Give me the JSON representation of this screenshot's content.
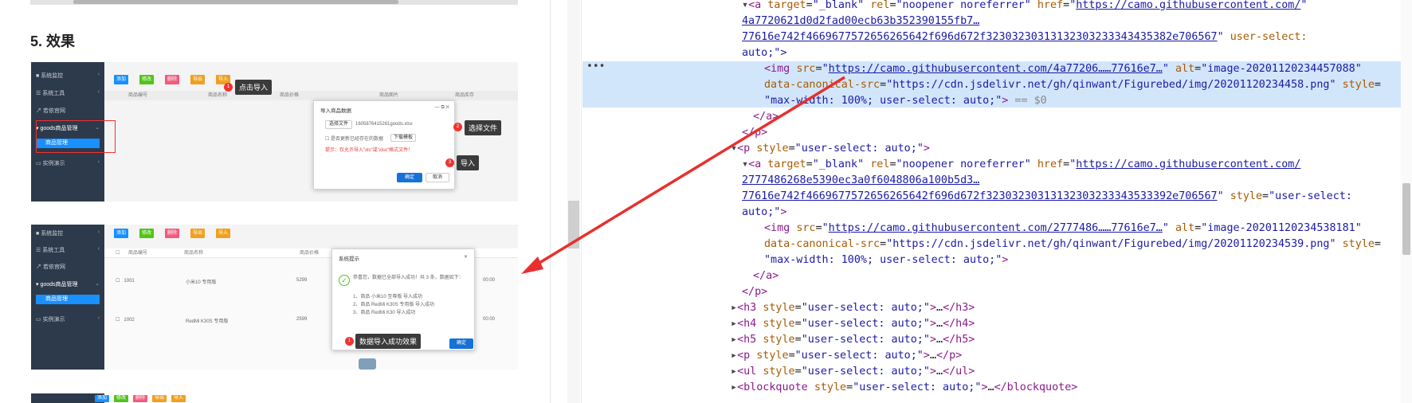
{
  "article": {
    "heading": "5. 效果",
    "shot1": {
      "menu": [
        "系统监控",
        "系统工具",
        "若依官网",
        "goods商品管理"
      ],
      "submenu": "商品管理",
      "toolbar": [
        "添加",
        "修改",
        "删除",
        "导出",
        "导入"
      ],
      "columns": [
        "商品编号",
        "商品名称",
        "商品价格",
        "商品图片",
        "商品库存"
      ],
      "dialog_title": "导入商品数据",
      "choose_file": "选择文件",
      "filename": "1605876415261goods.xlsx",
      "update_option": "是否更新已经存在的数据",
      "download_template": "下载模板",
      "hint": "提示：仅允许导入\"xls\"或\"xlsx\"格式文件！",
      "confirm": "确定",
      "cancel": "取消",
      "steps": [
        "点击导入",
        "选择文件",
        "导入"
      ],
      "nums": [
        "1",
        "2",
        "3"
      ]
    },
    "shot2": {
      "menu": [
        "系统监控",
        "系统工具",
        "若依官网",
        "goods商品管理",
        "实例演示"
      ],
      "submenu": "商品管理",
      "toolbar": [
        "添加",
        "修改",
        "删除",
        "导出",
        "导入"
      ],
      "columns": [
        "商品编号",
        "商品名称",
        "商品价格"
      ],
      "rows": [
        [
          "1001",
          "小米10 专用版",
          "5299"
        ],
        [
          "1002",
          "RedMi K30S 专用版",
          "2599"
        ]
      ],
      "dialog_title": "系统提示",
      "success_msg": "恭喜您，数据已全部导入成功！共 3 条，数据如下：",
      "items": [
        "1、商品 小米10 至尊版 导入成功",
        "2、商品 RedMi K30S 专用版 导入成功",
        "3、商品 RedMi K30 导入成功"
      ],
      "ok": "确定",
      "step": "数据导入成功效果",
      "num": "1",
      "time_snippet": [
        "00:00",
        "00:00"
      ]
    },
    "shot3_toolbar": [
      "添加",
      "修改",
      "删除",
      "导出",
      "导入"
    ]
  },
  "devtools": {
    "dots": "•••",
    "line1_href": "https://camo.githubusercontent.com/",
    "line2_href": "4a7720621d0d2fad00ecb63b352390155fb7…",
    "line3_href": "77616e742f4669677572656265642f696d672f32303230313132303233343435382e706567",
    "line3_style": "user-select:",
    "line4": "auto;\">",
    "sel_img_src": "https://camo.githubusercontent.com/4a77206……77616e7…",
    "sel_img_alt": "image-20201120234457088",
    "sel_canon": "https://cdn.jsdelivr.net/gh/qinwant/Figurebed/img/20201120234458.png",
    "sel_style_val": "max-width: 100%; user-select: auto;",
    "sel_eq": "== $0",
    "close_a": "</a>",
    "close_p": "</p>",
    "p_open_style": "user-select: auto;",
    "a2_href1": "https://camo.githubusercontent.com/",
    "a2_href2": "2777486268e5390ec3a0f6048806a100b5d3…",
    "a2_href3": "77616e742f4669677572656265642f696d672f32303230313132303233343533392e706567",
    "img2_src": "https://camo.githubusercontent.com/2777486……77616e7…",
    "img2_alt": "image-20201120234538181",
    "img2_canon": "https://cdn.jsdelivr.net/gh/qinwant/Figurebed/img/20201120234539.png",
    "collapsed": [
      {
        "tag": "h3"
      },
      {
        "tag": "h4"
      },
      {
        "tag": "h5"
      },
      {
        "tag": "p"
      },
      {
        "tag": "ul"
      },
      {
        "tag": "blockquote"
      }
    ]
  }
}
